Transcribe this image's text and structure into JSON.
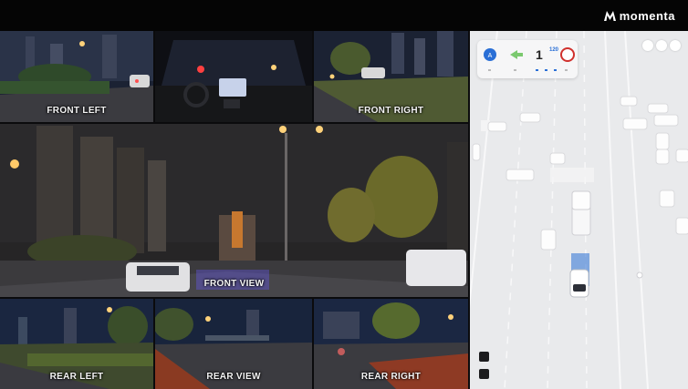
{
  "brand": {
    "name": "momenta"
  },
  "cameras": {
    "front_left": "FRONT LEFT",
    "front_right": "FRONT RIGHT",
    "front_view": "FRONT VIEW",
    "rear_left": "REAR LEFT",
    "rear_view": "REAR VIEW",
    "rear_right": "REAR RIGHT"
  },
  "hud": {
    "speed": "1",
    "speed_limit": "120"
  },
  "colors": {
    "accent": "#2a6fd6",
    "night_sky": "#1a2236",
    "map_bg": "#e9eaec",
    "limit_ring": "#d0312d"
  }
}
